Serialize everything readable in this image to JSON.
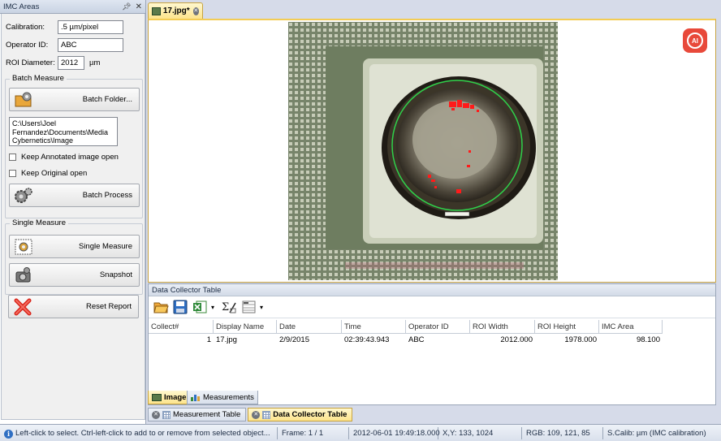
{
  "left_panel": {
    "title": "IMC Areas",
    "pin_icon": "pin-icon",
    "close_icon": "close-icon",
    "calibration_label": "Calibration:",
    "calibration_value": ".5 µm/pixel",
    "operator_label": "Operator ID:",
    "operator_value": "ABC",
    "roi_label": "ROI Diameter:",
    "roi_value": "2012",
    "roi_unit": "µm",
    "batch_group_title": "Batch Measure",
    "batch_folder_label": "Batch Folder...",
    "batch_path": "C:\\Users\\Joel Fernandez\\Documents\\Media Cybernetics\\Image",
    "keep_annotated_label": "Keep Annotated image open",
    "keep_original_label": "Keep Original open",
    "batch_process_label": "Batch Process",
    "single_group_title": "Single Measure",
    "single_measure_label": "Single Measure",
    "snapshot_label": "Snapshot",
    "reset_report_label": "Reset Report"
  },
  "document": {
    "tab_label": "17.jpg*",
    "ai_badge": "AI"
  },
  "data_collector": {
    "title": "Data Collector Table",
    "columns": [
      "Collect#",
      "Display Name",
      "Date",
      "Time",
      "Operator ID",
      "ROI Width",
      "ROI Height",
      "IMC Area"
    ],
    "rows": [
      [
        "1",
        "17.jpg",
        "2/9/2015",
        "02:39:43.943",
        "ABC",
        "2012.000",
        "1978.000",
        "98.100"
      ]
    ]
  },
  "view_tabs": {
    "image_tab": "Image",
    "measurements_tab": "Measurements"
  },
  "panel_tabs": {
    "measurement_table": "Measurement Table",
    "data_collector_table": "Data Collector Table"
  },
  "statusbar": {
    "hint": "Left-click to select.  Ctrl-left-click to add to or remove from selected object...",
    "frame": "Frame: 1 / 1",
    "datetime": "2012-06-01 19:49:18.000",
    "xy": "X,Y: 133, 1024",
    "rgb": "RGB:  109,  121,   85",
    "calib": "S.Calib: µm (IMC calibration)"
  },
  "colors": {
    "accent_tab": "#fde48c",
    "ai_badge": "#e8493a",
    "roi_circle": "#2fd04a",
    "defect": "#ff1a1a"
  }
}
